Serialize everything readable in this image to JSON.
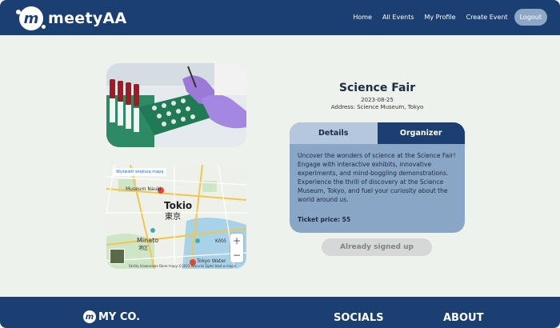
{
  "nav": {
    "logo_glyph": "m",
    "brand": "meetyAA",
    "links": [
      "Home",
      "All Events",
      "My Profile",
      "Create Event"
    ],
    "logout": "Logout"
  },
  "event": {
    "title": "Science Fair",
    "date": "2023-08-25",
    "address": "Address: Science Museum, Tokyo",
    "description": "Uncover the wonders of science at the Science Fair! Engage with interactive exhibits, innovative experiments, and mind-boggling demonstrations. Experience the thrill of discovery at the Science Museum, Tokyo, and fuel your curiosity about the world around us.",
    "price": "Ticket price: 55"
  },
  "tabs": {
    "details": "Details",
    "organizer": "Organizer"
  },
  "signed_button": "Already signed up",
  "map": {
    "link": "Wyświetl większą mapę",
    "city": "Tokio",
    "city_jp": "東京",
    "labels": [
      "Museum Nauki",
      "Minato",
      "港区",
      "Kōtō",
      "Tokyo Water"
    ],
    "attribution": "Skróty klawiszowe   Dane mapy ©2023   Warunki   Zgłoś błąd w mapie"
  },
  "footer": {
    "logo_glyph": "m",
    "brand": "MY CO.",
    "socials": "SOCIALS",
    "about": "ABOUT"
  }
}
